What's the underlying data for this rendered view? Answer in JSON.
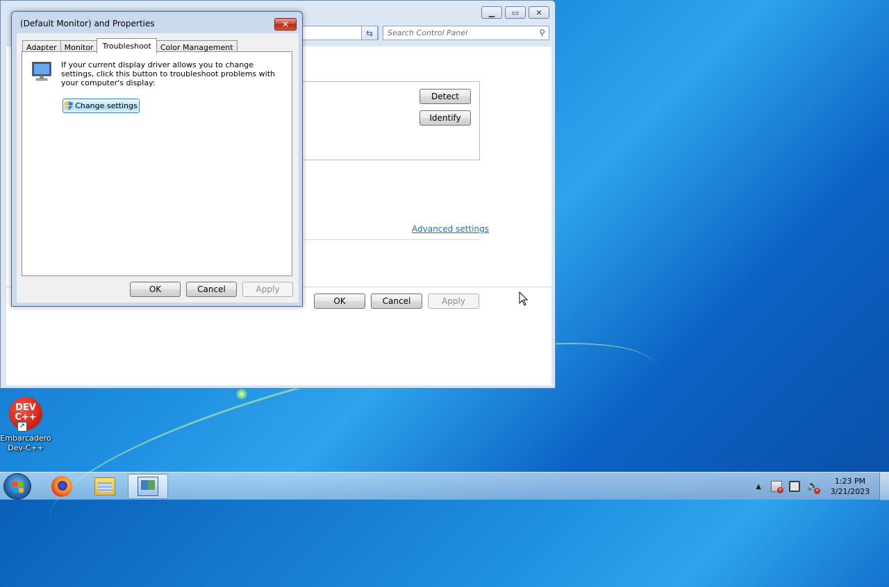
{
  "control_panel": {
    "search_placeholder": "Search Control Panel",
    "detect_label": "Detect",
    "identify_label": "Identify",
    "advanced_settings_label": "Advanced settings",
    "ok_label": "OK",
    "cancel_label": "Cancel",
    "apply_label": "Apply"
  },
  "dialog": {
    "title": "(Default Monitor) and  Properties",
    "close_label": "✕",
    "tabs": [
      {
        "label": "Adapter"
      },
      {
        "label": "Monitor"
      },
      {
        "label": "Troubleshoot"
      },
      {
        "label": "Color Management"
      }
    ],
    "active_tab": "Troubleshoot",
    "troubleshoot_text": "If your current display driver allows you to change settings, click this button to troubleshoot problems with your computer's display:",
    "change_settings_label": "Change settings",
    "ok_label": "OK",
    "cancel_label": "Cancel",
    "apply_label": "Apply"
  },
  "desktop": {
    "icons": [
      {
        "label": "Embarcadero Dev-C++",
        "logo_text_top": "DEV",
        "logo_text_bottom": "C++",
        "icon": "devcpp-icon"
      }
    ]
  },
  "taskbar": {
    "items": [
      {
        "name": "firefox",
        "icon": "firefox-icon"
      },
      {
        "name": "windows-explorer",
        "icon": "folder-icon"
      },
      {
        "name": "control-panel",
        "icon": "control-panel-icon",
        "active": true
      }
    ],
    "clock_time": "1:23 PM",
    "clock_date": "3/21/2023"
  },
  "colors": {
    "dialog_frame": "#c9daee",
    "close_button": "#c7442b",
    "link": "#1a6fc2",
    "taskbar": "#a0c4e4"
  }
}
